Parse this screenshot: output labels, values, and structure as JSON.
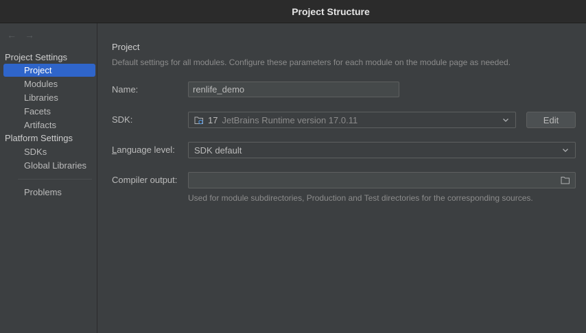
{
  "window": {
    "title": "Project Structure"
  },
  "sidebar": {
    "nav_back": "←",
    "nav_forward": "→",
    "project_settings_header": "Project Settings",
    "project_items": [
      {
        "label": "Project",
        "selected": true
      },
      {
        "label": "Modules",
        "selected": false
      },
      {
        "label": "Libraries",
        "selected": false
      },
      {
        "label": "Facets",
        "selected": false
      },
      {
        "label": "Artifacts",
        "selected": false
      }
    ],
    "platform_settings_header": "Platform Settings",
    "platform_items": [
      {
        "label": "SDKs"
      },
      {
        "label": "Global Libraries"
      }
    ],
    "problems_label": "Problems"
  },
  "main": {
    "title": "Project",
    "description": "Default settings for all modules. Configure these parameters for each module on the module page as needed.",
    "name": {
      "label": "Name:",
      "value": "renlife_demo"
    },
    "sdk": {
      "label": "SDK:",
      "version": "17",
      "name": "JetBrains Runtime version 17.0.11",
      "edit_label": "Edit"
    },
    "language_level": {
      "label_prefix": "L",
      "label_rest": "anguage level:",
      "value": "SDK default"
    },
    "compiler_output": {
      "label": "Compiler output:",
      "value": "",
      "hint": "Used for module subdirectories, Production and Test directories for the corresponding sources."
    }
  },
  "colors": {
    "selection": "#2f65ca",
    "background": "#3c3f41",
    "titlebar": "#2b2b2b"
  },
  "icons": {
    "sdk": "folder-with-sdk-icon",
    "browse": "folder-icon",
    "dropdown": "chevron-down-icon"
  }
}
